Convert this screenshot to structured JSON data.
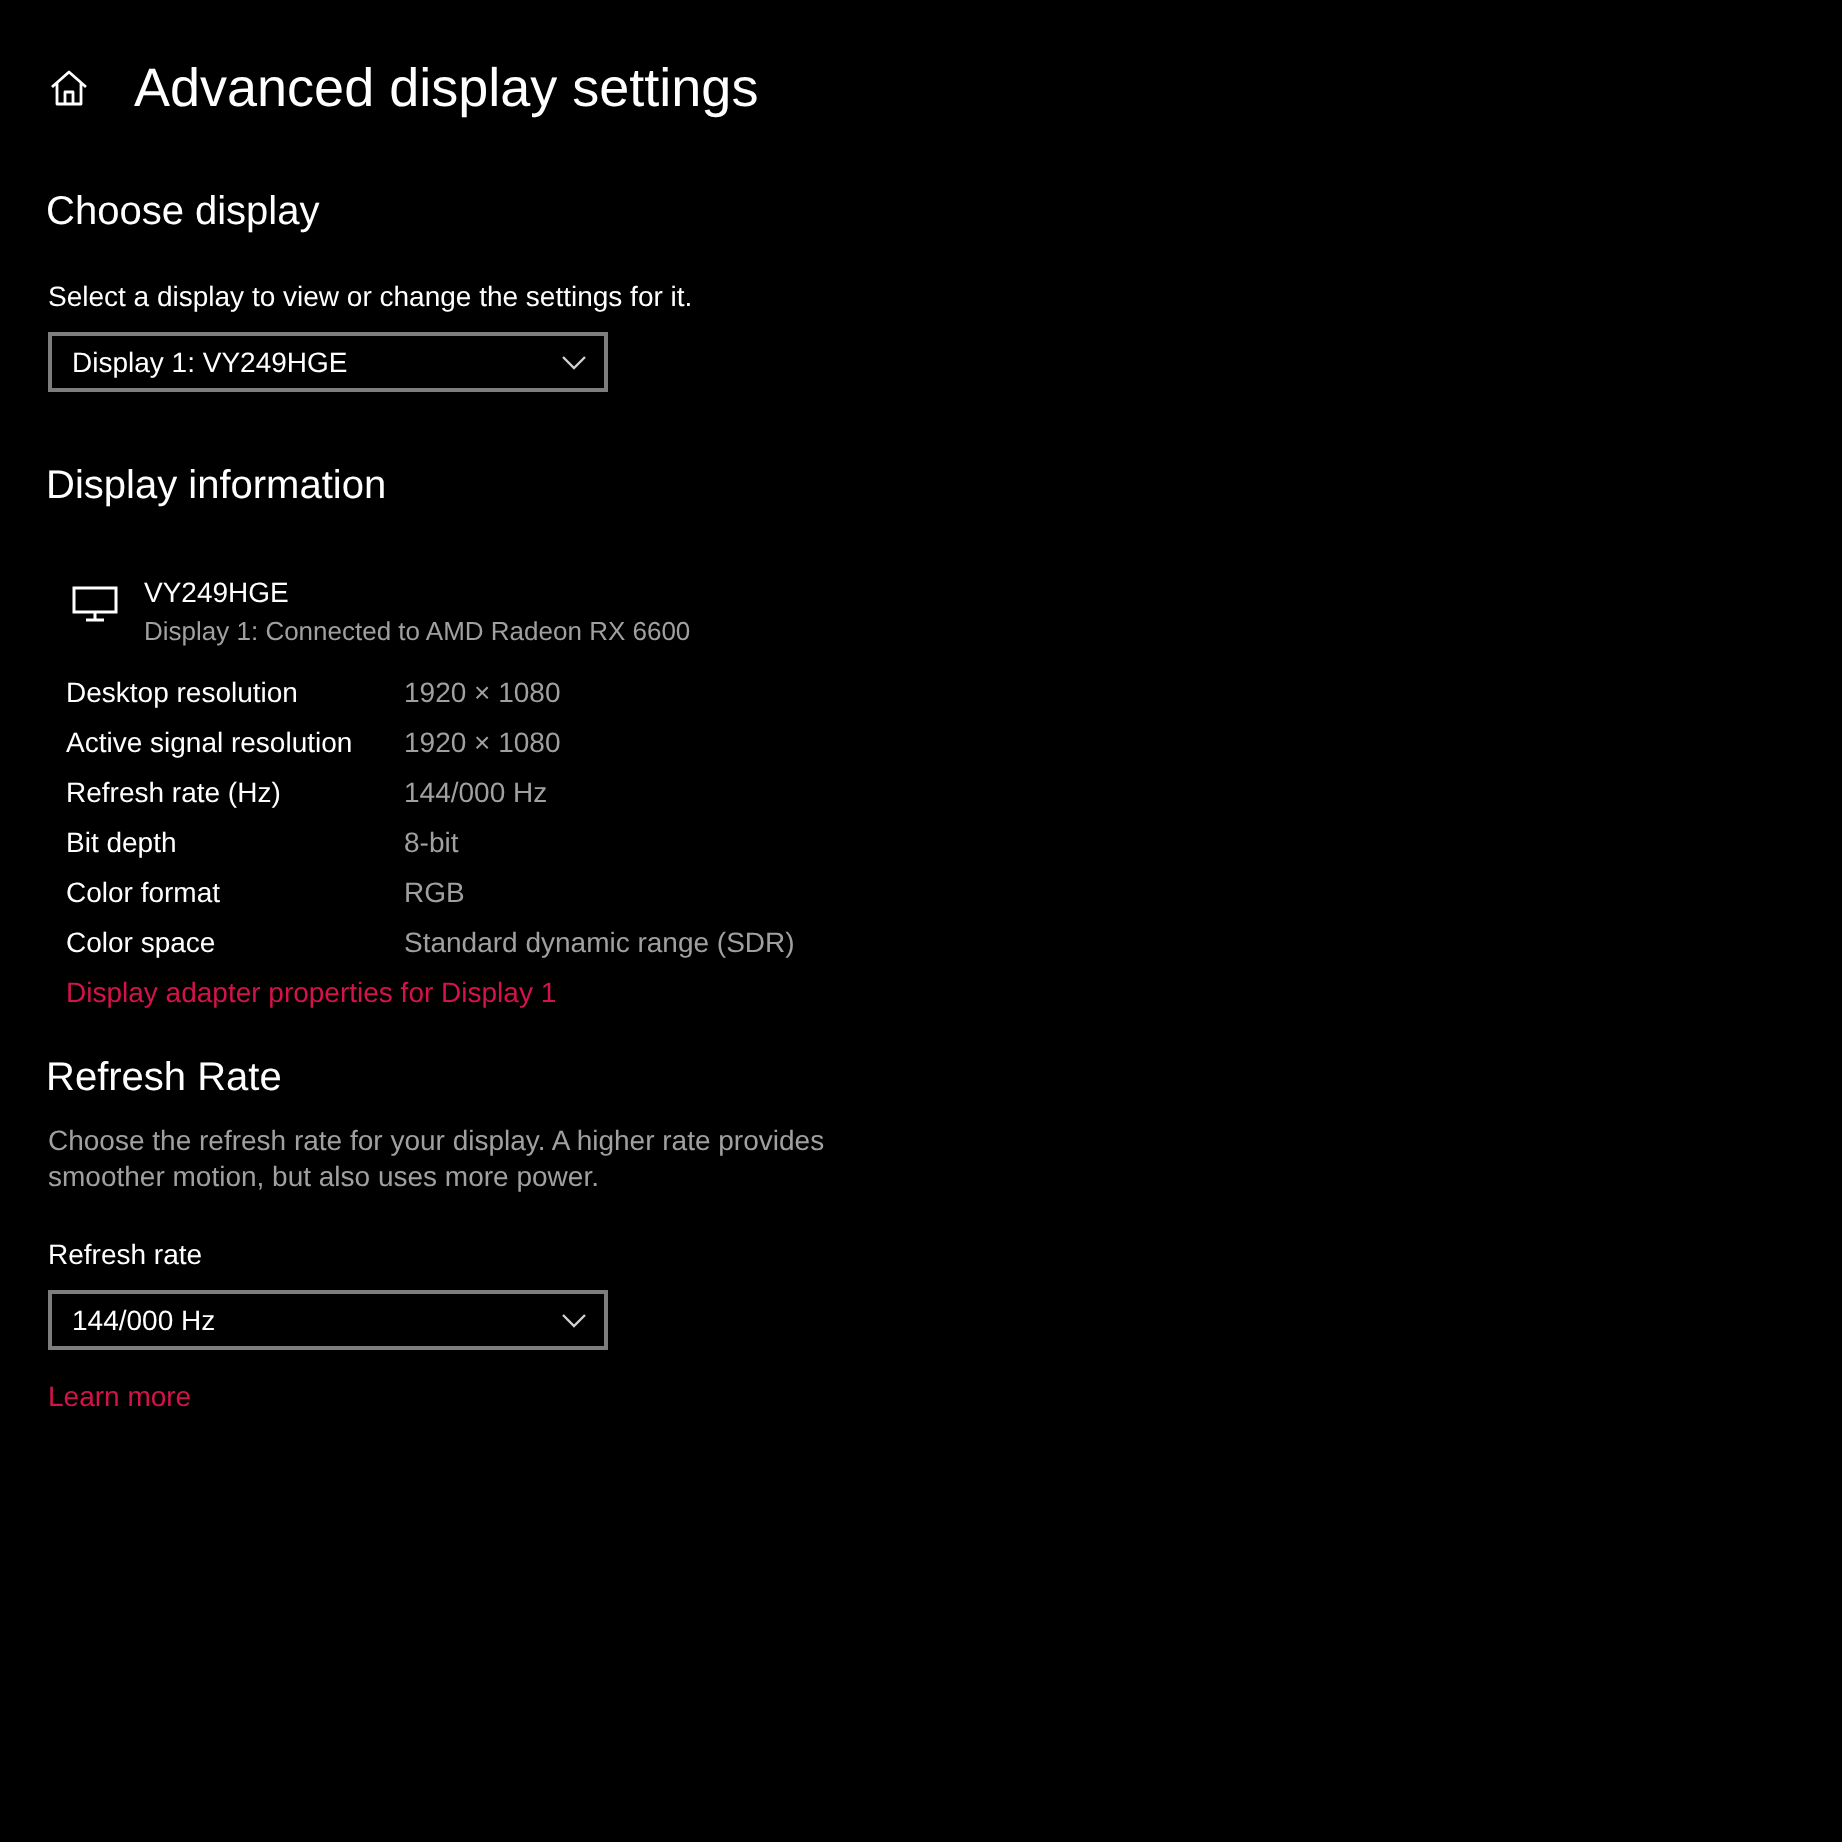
{
  "page": {
    "title": "Advanced display settings"
  },
  "choose_display": {
    "heading": "Choose display",
    "label": "Select a display to view or change the settings for it.",
    "dropdown": {
      "value": "Display 1: VY249HGE"
    }
  },
  "display_information": {
    "heading": "Display information",
    "monitor": {
      "name": "VY249HGE",
      "description": "Display 1: Connected to AMD Radeon RX 6600"
    },
    "rows": [
      {
        "label": "Desktop resolution",
        "value": "1920 × 1080"
      },
      {
        "label": "Active signal resolution",
        "value": "1920 × 1080"
      },
      {
        "label": "Refresh rate (Hz)",
        "value": "144/000 Hz"
      },
      {
        "label": "Bit depth",
        "value": "8-bit"
      },
      {
        "label": "Color format",
        "value": "RGB"
      },
      {
        "label": "Color space",
        "value": "Standard dynamic range (SDR)"
      }
    ],
    "link": "Display adapter properties for Display 1"
  },
  "refresh_rate": {
    "heading": "Refresh Rate",
    "description": "Choose the refresh rate for your display. A higher rate provides smoother motion, but also uses more power.",
    "label": "Refresh rate",
    "dropdown": {
      "value": "144/000 Hz"
    },
    "link": "Learn more"
  }
}
